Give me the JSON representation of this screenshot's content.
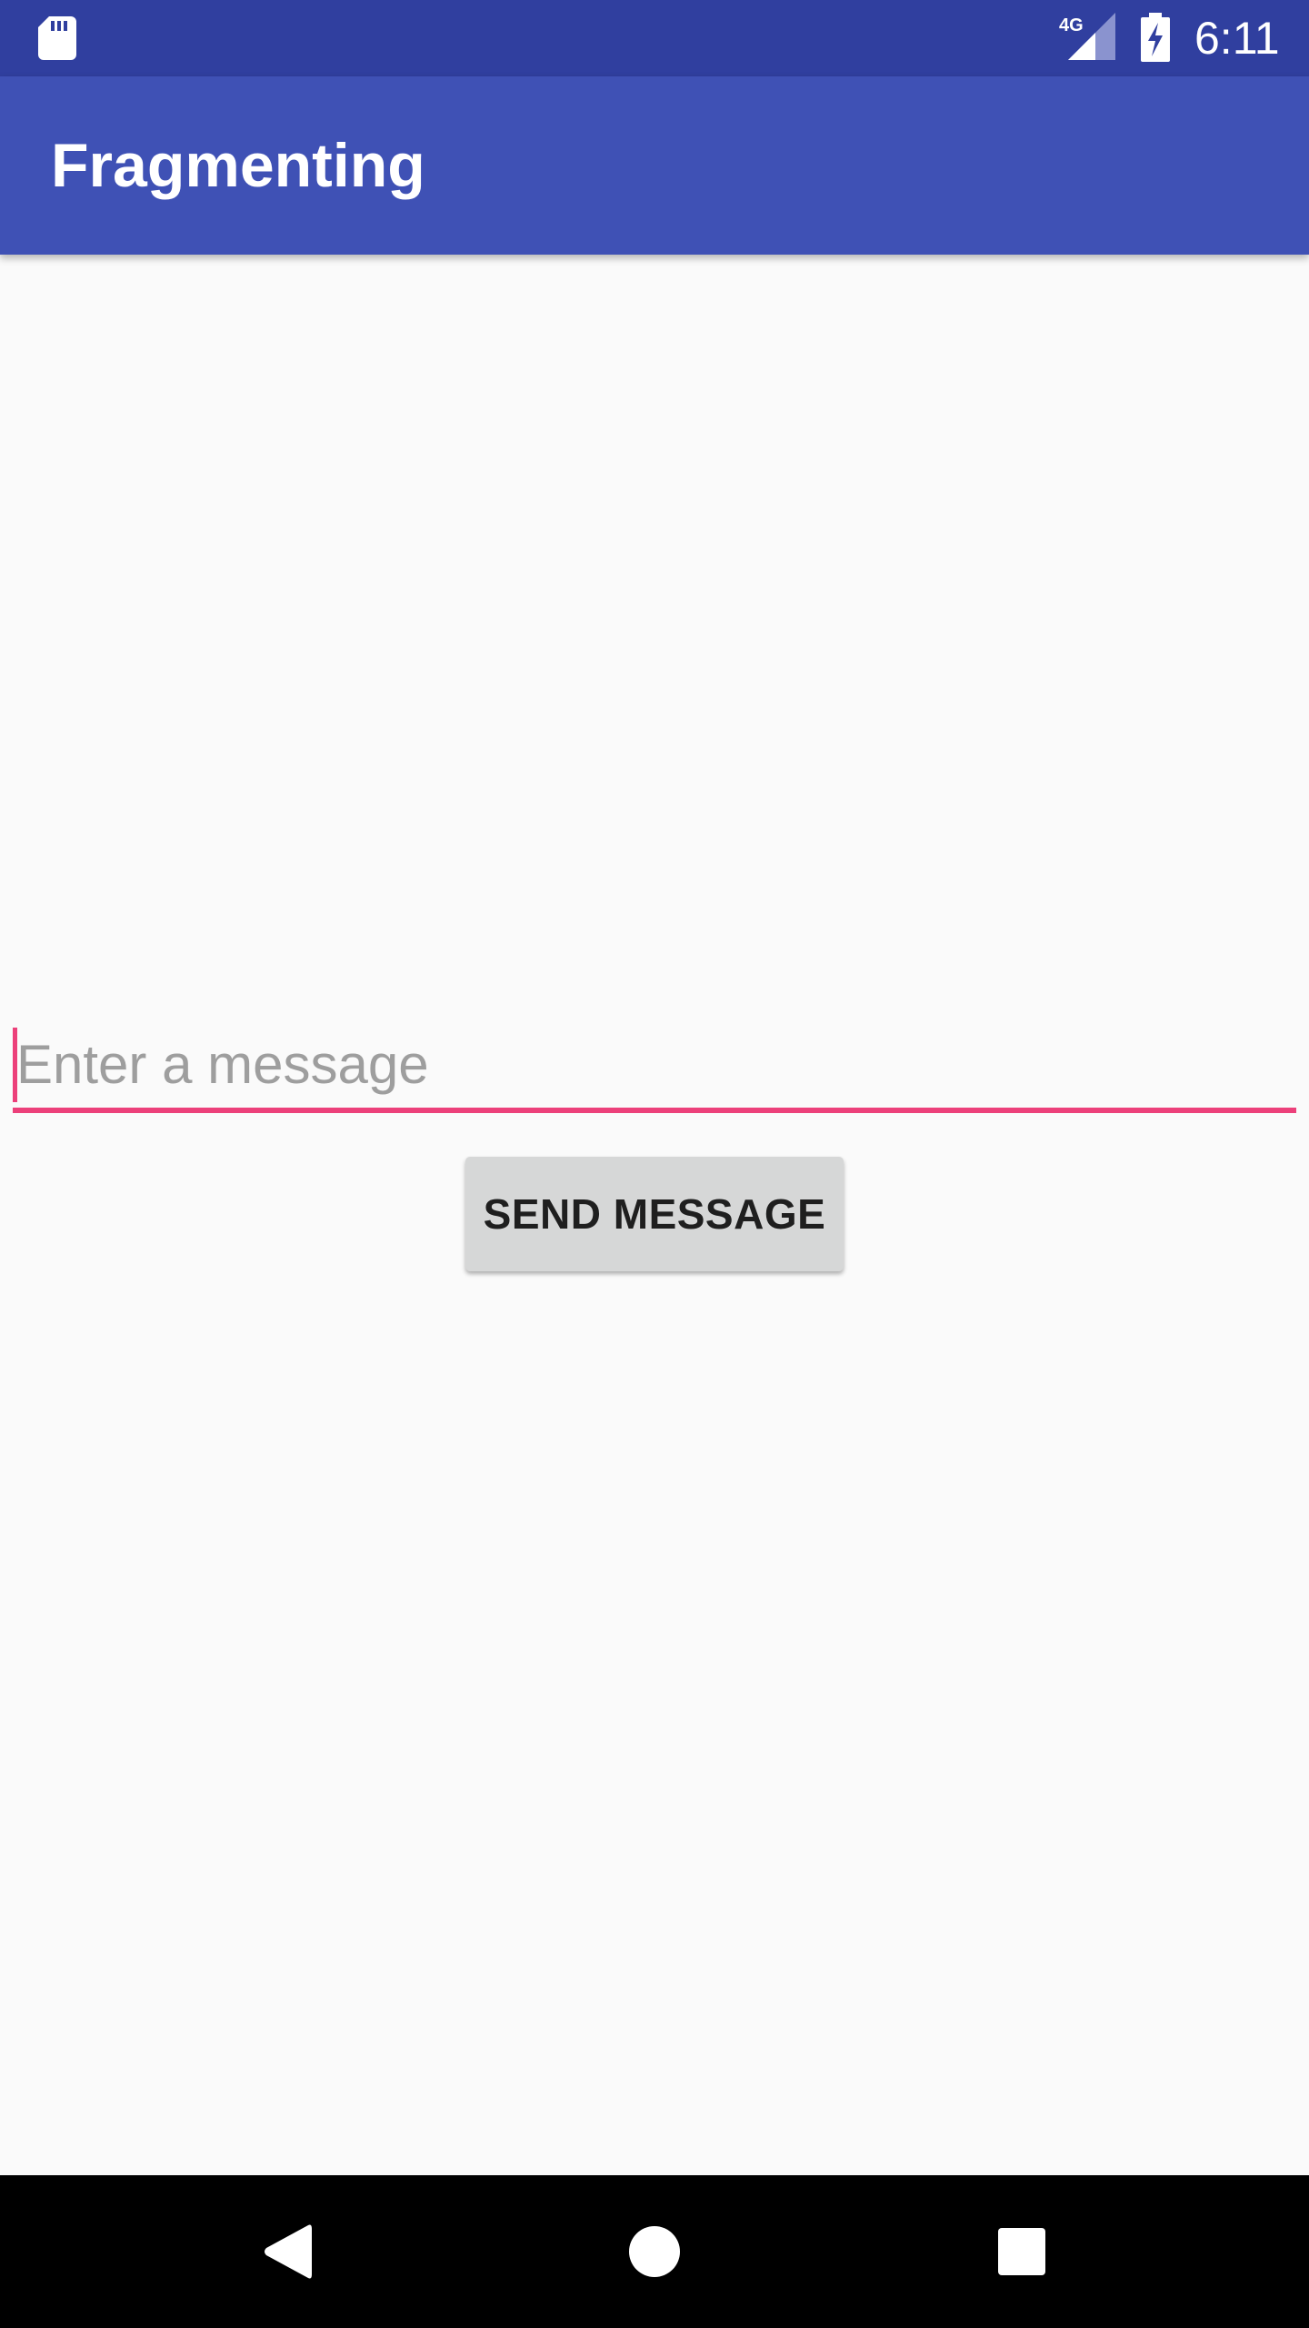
{
  "status_bar": {
    "time": "6:11",
    "network_label": "4G",
    "icons": [
      "sd-card-icon",
      "signal-4g-icon",
      "battery-charging-icon"
    ]
  },
  "app_bar": {
    "title": "Fragmenting"
  },
  "message_form": {
    "input_value": "",
    "input_placeholder": "Enter a message",
    "send_label": "SEND MESSAGE"
  },
  "nav_bar": {
    "icons": [
      "back-icon",
      "home-icon",
      "recents-icon"
    ]
  },
  "colors": {
    "status_bar": "#303f9f",
    "app_bar": "#3f51b5",
    "accent": "#ec407a",
    "background": "#fafafa",
    "button": "#d6d7d7",
    "nav_bar": "#000000"
  }
}
